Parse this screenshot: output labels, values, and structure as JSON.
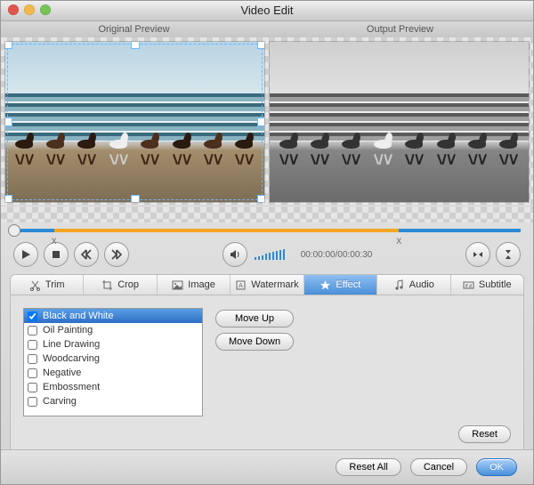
{
  "window": {
    "title": "Video Edit"
  },
  "traffic": {
    "close": "#e0554f",
    "min": "#f1b94c",
    "zoom": "#78c257"
  },
  "previewLabels": {
    "left": "Original Preview",
    "right": "Output Preview"
  },
  "timeline": {
    "blue_start_pct": 0,
    "blue_end_a_pct": 8,
    "range_start_pct": 8,
    "range_end_pct": 76,
    "blue_end_b_start_pct": 76,
    "blue_end_b_end_pct": 100,
    "playhead_pct": 0
  },
  "timecode": "00:00:00/00:00:30",
  "tabs": [
    {
      "icon": "scissors-icon",
      "label": "Trim"
    },
    {
      "icon": "crop-icon",
      "label": "Crop"
    },
    {
      "icon": "image-icon",
      "label": "Image"
    },
    {
      "icon": "watermark-icon",
      "label": "Watermark"
    },
    {
      "icon": "star-icon",
      "label": "Effect",
      "active": true
    },
    {
      "icon": "music-note-icon",
      "label": "Audio"
    },
    {
      "icon": "subtitle-icon",
      "label": "Subtitle"
    }
  ],
  "effects": {
    "items": [
      {
        "label": "Black and White",
        "checked": true,
        "selected": true
      },
      {
        "label": "Oil Painting",
        "checked": false
      },
      {
        "label": "Line Drawing",
        "checked": false
      },
      {
        "label": "Woodcarving",
        "checked": false
      },
      {
        "label": "Negative",
        "checked": false
      },
      {
        "label": "Embossment",
        "checked": false
      },
      {
        "label": "Carving",
        "checked": false
      }
    ]
  },
  "buttons": {
    "move_up": "Move Up",
    "move_down": "Move Down",
    "reset": "Reset",
    "reset_all": "Reset All",
    "cancel": "Cancel",
    "ok": "OK"
  },
  "playback": {
    "play": "play-icon",
    "stop": "stop-icon",
    "prev_key": "prev-keyframe-icon",
    "next_key": "next-keyframe-icon",
    "volume": "volume-icon",
    "flip_h": "flip-horizontal-icon",
    "flip_v": "flip-vertical-icon"
  }
}
